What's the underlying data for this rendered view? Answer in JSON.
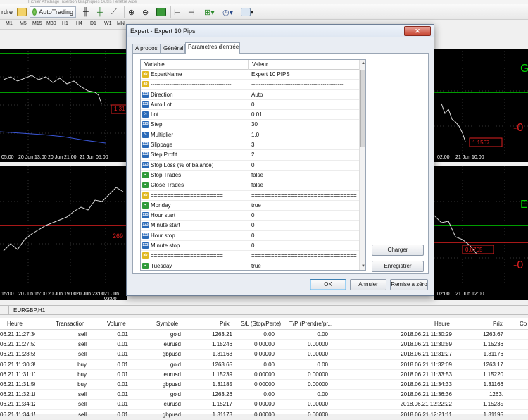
{
  "window": {
    "menu_text": "Fichier  Affichage  Insertion  Graphiques  Outils  Fenêtre  Aide"
  },
  "toolbar": {
    "partial_left_label": "rdre",
    "autotrading_label": "AutoTrading"
  },
  "periods": [
    "M1",
    "M5",
    "M15",
    "M30",
    "H1",
    "H4",
    "D1",
    "W1",
    "MN"
  ],
  "charts": {
    "top_left": {
      "time_labels": [
        "05:00",
        "20 Jun 13:00",
        "20 Jun 21:00",
        "21 Jun 05:00"
      ],
      "price_box": "1.31"
    },
    "top_right": {
      "time_labels": [
        "02:00",
        "21 Jun 10:00"
      ],
      "big_label": "-0",
      "price_box": "1.1567",
      "corner_letter": "G"
    },
    "bottom_left": {
      "time_labels": [
        "15:00",
        "20 Jun 15:00",
        "20 Jun 19:00",
        "20 Jun 23:00",
        "21 Jun 03:00"
      ],
      "level_label": "269"
    },
    "bottom_right": {
      "time_labels": [
        "02:00",
        "21 Jun 12:00"
      ],
      "big_label": "-0",
      "price_box": "0.0705",
      "corner_letter": "E"
    }
  },
  "dialog": {
    "title": "Expert - Expert 10 Pips",
    "close_label": "✕",
    "tabs": [
      "A propos",
      "Général",
      "Parametres d'entrée"
    ],
    "active_tab": 2,
    "columns": {
      "variable": "Variable",
      "value": "Valeur"
    },
    "params": [
      {
        "type": "ab",
        "name": "ExpertName",
        "value": "Expert 10 PIPS"
      },
      {
        "type": "ab",
        "name": "-------------------------------------------",
        "value": "-------------------------------------------------"
      },
      {
        "type": "123",
        "name": "Direction",
        "value": "Auto"
      },
      {
        "type": "123",
        "name": "Auto Lot",
        "value": "0"
      },
      {
        "type": "v2",
        "name": "Lot",
        "value": "0.01"
      },
      {
        "type": "123",
        "name": "Step",
        "value": "30"
      },
      {
        "type": "v2",
        "name": "Multiplier",
        "value": "1.0"
      },
      {
        "type": "123",
        "name": "Slippage",
        "value": "3"
      },
      {
        "type": "123",
        "name": "Step Profit",
        "value": "2"
      },
      {
        "type": "123",
        "name": "Stop Loss (% of balance)",
        "value": "0"
      },
      {
        "type": "bool",
        "name": "Stop Trades",
        "value": "false"
      },
      {
        "type": "bool",
        "name": "Close Trades",
        "value": "false"
      },
      {
        "type": "ab",
        "name": "======================",
        "value": "=================================="
      },
      {
        "type": "bool",
        "name": "Monday",
        "value": "true"
      },
      {
        "type": "123",
        "name": "Hour start",
        "value": "0"
      },
      {
        "type": "123",
        "name": "Minute start",
        "value": "0"
      },
      {
        "type": "123",
        "name": "Hour stop",
        "value": "0"
      },
      {
        "type": "123",
        "name": "Minute stop",
        "value": "0"
      },
      {
        "type": "ab",
        "name": "======================",
        "value": "=================================="
      },
      {
        "type": "bool",
        "name": "Tuesday",
        "value": "true"
      }
    ],
    "buttons": {
      "load": "Charger",
      "save": "Enregistrer",
      "ok": "OK",
      "cancel": "Annuler",
      "reset": "Remise a zéro"
    }
  },
  "chart_tab": "EURGBP,H1",
  "terminal": {
    "columns": [
      "Heure",
      "Transaction",
      "Volume",
      "Symbole",
      "Prix",
      "S/L (Stop/Perte)",
      "T/P (Prendre/pr...",
      "Heure",
      "Prix",
      "Co"
    ],
    "rows": [
      [
        "06.21 11:27:34",
        "sell",
        "0.01",
        "gold",
        "1263.21",
        "0.00",
        "0.00",
        "2018.06.21 11:30:29",
        "1263.67"
      ],
      [
        "06.21 11:27:53",
        "sell",
        "0.01",
        "eurusd",
        "1.15246",
        "0.00000",
        "0.00000",
        "2018.06.21 11:30:59",
        "1.15236"
      ],
      [
        "06.21 11:28:55",
        "sell",
        "0.01",
        "gbpusd",
        "1.31163",
        "0.00000",
        "0.00000",
        "2018.06.21 11:31:27",
        "1.31176"
      ],
      [
        "06.21 11:30:39",
        "buy",
        "0.01",
        "gold",
        "1263.65",
        "0.00",
        "0.00",
        "2018.06.21 11:32:09",
        "1263.17"
      ],
      [
        "06.21 11:31:17",
        "buy",
        "0.01",
        "eurusd",
        "1.15239",
        "0.00000",
        "0.00000",
        "2018.06.21 11:33:53",
        "1.15220"
      ],
      [
        "06.21 11:31:56",
        "buy",
        "0.01",
        "gbpusd",
        "1.31185",
        "0.00000",
        "0.00000",
        "2018.06.21 11:34:33",
        "1.31166"
      ],
      [
        "06.21 11:32:18",
        "sell",
        "0.01",
        "gold",
        "1263.26",
        "0.00",
        "0.00",
        "2018.06.21 11:36:36",
        "1263."
      ],
      [
        "06.21 11:34:12",
        "sell",
        "0.01",
        "eurusd",
        "1.15217",
        "0.00000",
        "0.00000",
        "2018.06.21 12:22:22",
        "1.15235"
      ],
      [
        "06.21 11:34:15",
        "sell",
        "0.01",
        "gbpusd",
        "1.31173",
        "0.00000",
        "0.00000",
        "2018.06.21 12:21:11",
        "1.31195"
      ]
    ]
  }
}
